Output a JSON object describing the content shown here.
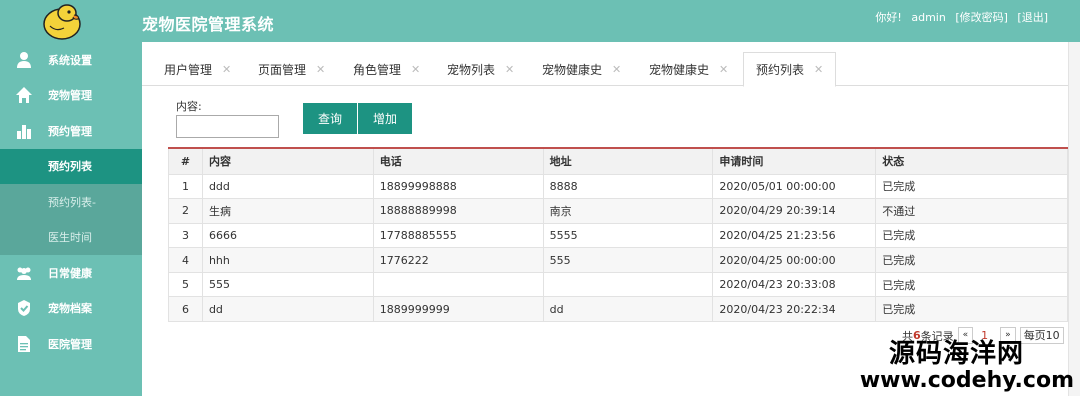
{
  "app": {
    "title": "宠物医院管理系统"
  },
  "user": {
    "greeting": "你好!",
    "name": "admin",
    "change_password": "[修改密码]",
    "logout": "[退出]"
  },
  "sidebar": {
    "items": [
      {
        "label": "系统设置",
        "icon": "user-icon"
      },
      {
        "label": "宠物管理",
        "icon": "home-icon"
      },
      {
        "label": "预约管理",
        "icon": "bar-chart-icon"
      },
      {
        "label": "预约列表",
        "sub": true,
        "active": true
      },
      {
        "label": "预约列表-",
        "sub": true
      },
      {
        "label": "医生时间",
        "sub": true
      },
      {
        "label": "日常健康",
        "icon": "group-icon"
      },
      {
        "label": "宠物档案",
        "icon": "check-badge-icon"
      },
      {
        "label": "医院管理",
        "icon": "document-icon"
      }
    ]
  },
  "tabs": [
    {
      "label": "用户管理"
    },
    {
      "label": "页面管理"
    },
    {
      "label": "角色管理"
    },
    {
      "label": "宠物列表"
    },
    {
      "label": "宠物健康史"
    },
    {
      "label": "宠物健康史"
    },
    {
      "label": "预约列表",
      "active": true
    }
  ],
  "tab_close": "✕",
  "search": {
    "label": "内容:",
    "value": "",
    "query_button": "查询",
    "add_button": "增加"
  },
  "table": {
    "headers": [
      "#",
      "内容",
      "电话",
      "地址",
      "申请时间",
      "状态"
    ],
    "rows": [
      [
        "1",
        "ddd",
        "18899998888",
        "8888",
        "2020/05/01 00:00:00",
        "已完成"
      ],
      [
        "2",
        "生病",
        "18888889998",
        "南京",
        "2020/04/29 20:39:14",
        "不通过"
      ],
      [
        "3",
        "6666",
        "17788885555",
        "5555",
        "2020/04/25 21:23:56",
        "已完成"
      ],
      [
        "4",
        "hhh",
        "1776222",
        "555",
        "2020/04/25 00:00:00",
        "已完成"
      ],
      [
        "5",
        "555",
        "",
        "",
        "2020/04/23 20:33:08",
        "已完成"
      ],
      [
        "6",
        "dd",
        "1889999999",
        "dd",
        "2020/04/23 20:22:34",
        "已完成"
      ]
    ]
  },
  "pager": {
    "prefix": "共",
    "count": "6",
    "suffix": "条记录",
    "prev": "«",
    "current": "1",
    "next": "»",
    "page_size": "每页10"
  },
  "watermark": {
    "line1": "源码海洋网",
    "line2": "www.codehy.com"
  },
  "colors": {
    "sidebar": "#6cc0b4",
    "active": "#1d9382",
    "submenu": "#5aa79b",
    "accent_red": "#c0504d"
  }
}
